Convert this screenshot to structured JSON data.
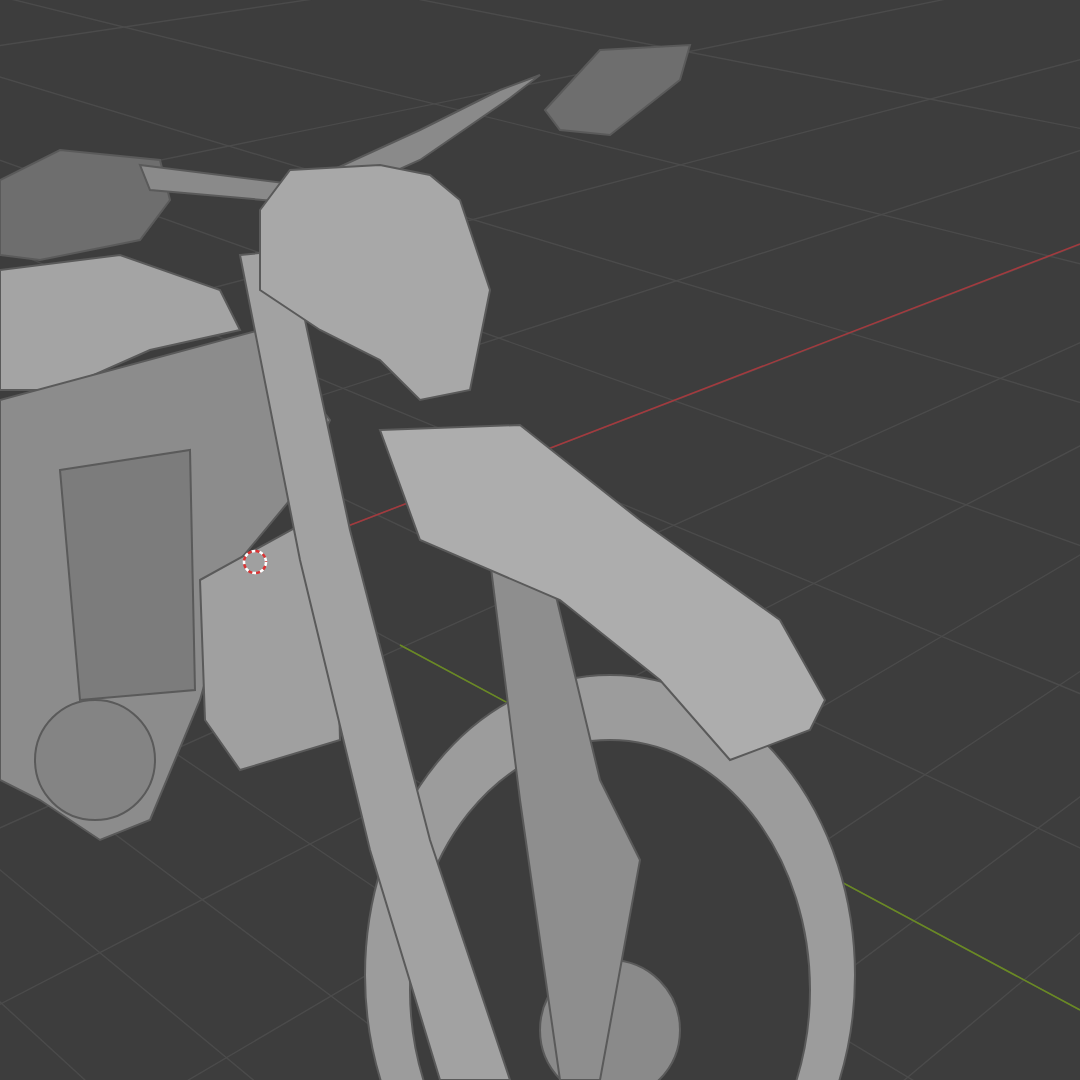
{
  "viewport": {
    "kind": "perspective",
    "show_grid": true,
    "show_axes": true,
    "show_cursor": true
  }
}
